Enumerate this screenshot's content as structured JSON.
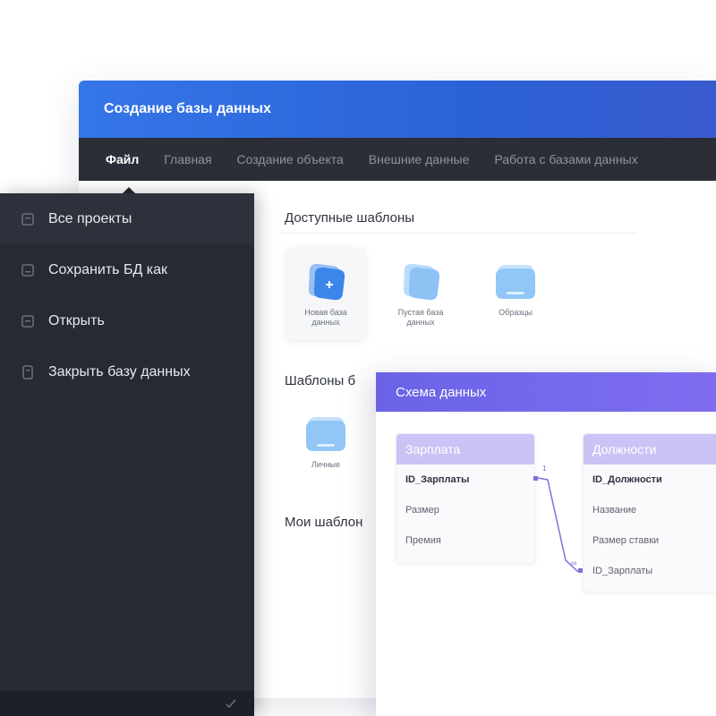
{
  "window": {
    "title": "Создание базы данных"
  },
  "menu": {
    "tabs": [
      {
        "label": "Файл",
        "active": true
      },
      {
        "label": "Главная",
        "active": false
      },
      {
        "label": "Создание объекта",
        "active": false
      },
      {
        "label": "Внешние данные",
        "active": false
      },
      {
        "label": "Работа с базами данных",
        "active": false
      }
    ]
  },
  "file_menu": {
    "items": [
      {
        "label": "Все проекты",
        "icon": "folder-icon"
      },
      {
        "label": "Сохранить БД как",
        "icon": "save-icon"
      },
      {
        "label": "Открыть",
        "icon": "open-icon"
      },
      {
        "label": "Закрыть базу данных",
        "icon": "close-db-icon"
      }
    ]
  },
  "templates": {
    "available_title": "Доступные шаблоны",
    "available": [
      {
        "label": "Новая база данных",
        "icon": "new-db-icon"
      },
      {
        "label": "Пустая база данных",
        "icon": "blank-db-icon"
      },
      {
        "label": "Образцы",
        "icon": "samples-icon"
      }
    ],
    "db_templates_title": "Шаблоны б",
    "db_templates": [
      {
        "label": "Личные",
        "icon": "personal-icon"
      }
    ],
    "my_templates_title": "Мои шаблон"
  },
  "schema": {
    "title": "Схема данных",
    "tables": [
      {
        "name": "Зарплата",
        "fields": [
          {
            "label": "ID_Зарплаты",
            "pk": true
          },
          {
            "label": "Размер",
            "pk": false
          },
          {
            "label": "Премия",
            "pk": false
          }
        ]
      },
      {
        "name": "Должности",
        "fields": [
          {
            "label": "ID_Должности",
            "pk": true
          },
          {
            "label": "Название",
            "pk": false
          },
          {
            "label": "Размер ставки",
            "pk": false
          },
          {
            "label": "ID_Зарплаты",
            "pk": false
          }
        ]
      }
    ],
    "relation": {
      "from_label": "1",
      "to_label": "∞"
    }
  },
  "colors": {
    "title_bar": "#2f6ce0",
    "menu_bar": "#2b2e36",
    "file_menu": "#262a33",
    "schema_header": "#7268ea",
    "table_header": "#c9c4f5",
    "template_icon": "#8ec2f5",
    "relation_line": "#7a72d8"
  }
}
